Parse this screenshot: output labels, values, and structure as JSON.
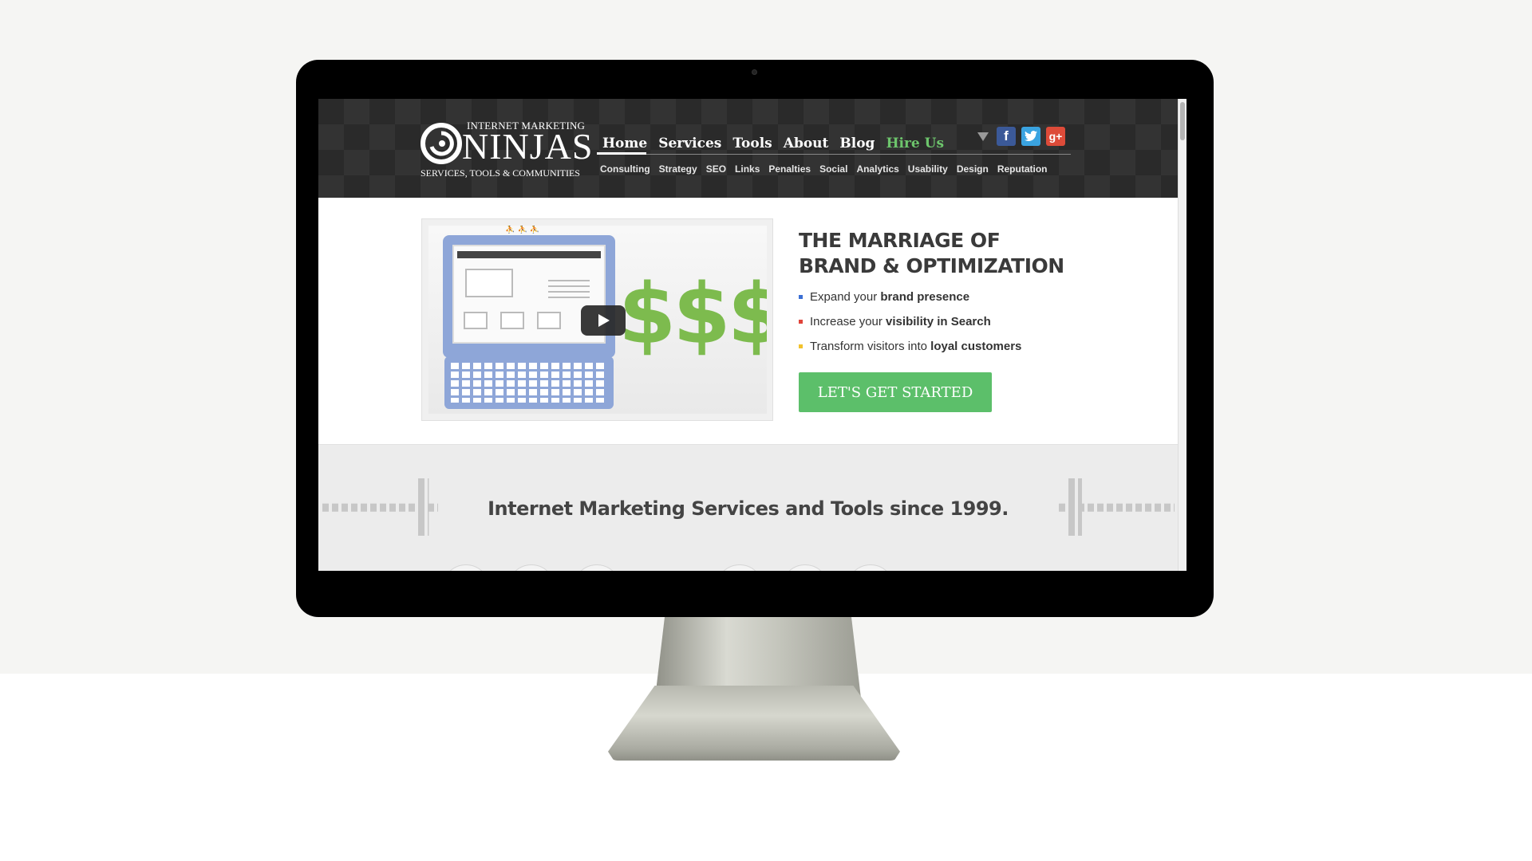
{
  "site": {
    "logo": {
      "top": "INTERNET MARKETING",
      "main": "NINJAS",
      "sub": "SERVICES, TOOLS & COMMUNITIES"
    },
    "main_nav": [
      {
        "label": "Home",
        "name": "nav-home"
      },
      {
        "label": "Services",
        "name": "nav-services"
      },
      {
        "label": "Tools",
        "name": "nav-tools"
      },
      {
        "label": "About",
        "name": "nav-about"
      },
      {
        "label": "Blog",
        "name": "nav-blog"
      },
      {
        "label": "Hire Us",
        "name": "nav-hire-us"
      }
    ],
    "active_nav": "Home",
    "sub_nav": [
      "Consulting",
      "Strategy",
      "SEO",
      "Links",
      "Penalties",
      "Social",
      "Analytics",
      "Usability",
      "Design",
      "Reputation"
    ],
    "social": {
      "facebook": "f",
      "twitter": "t",
      "googleplus": "g+"
    },
    "hero": {
      "title_line1": "THE MARRIAGE OF",
      "title_line2": "BRAND & OPTIMIZATION",
      "bullets": [
        {
          "pre": "Expand your ",
          "bold": "brand presence",
          "color": "#3b6fd4"
        },
        {
          "pre": "Increase your ",
          "bold": "visibility in Search",
          "color": "#e0443a"
        },
        {
          "pre": "Transform visitors into ",
          "bold": "loyal customers",
          "color": "#f2c22d"
        }
      ],
      "cta": "LET'S GET STARTED",
      "video_dollars": "$$$"
    },
    "band_title": "Internet Marketing Services and Tools since 1999."
  },
  "colors": {
    "accent_green": "#5cbf6a",
    "hire_us": "#6dc56c",
    "header_bg": "#2a2a2a"
  }
}
